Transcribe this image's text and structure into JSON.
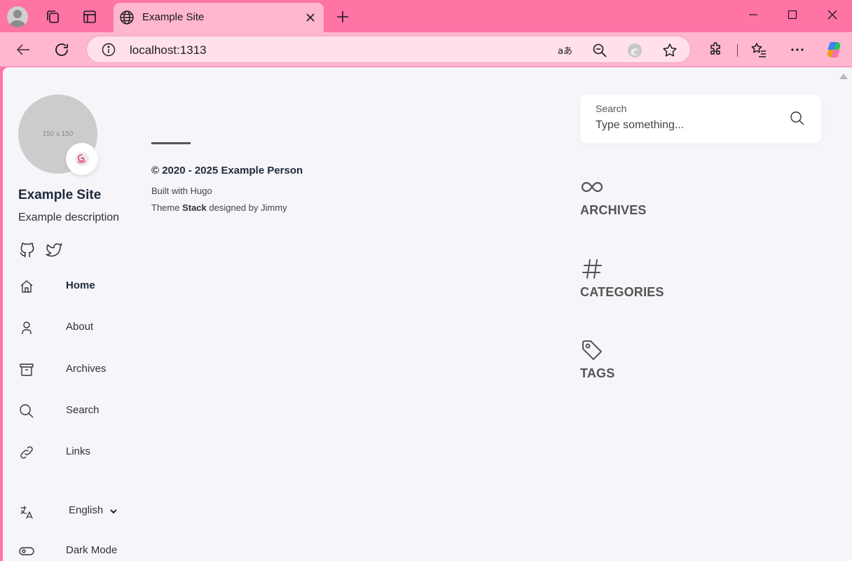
{
  "browser": {
    "tab": {
      "title": "Example Site"
    },
    "address_bar": {
      "url": "localhost:1313"
    }
  },
  "sidebar": {
    "avatar_placeholder": "150 x 150",
    "site_name": "Example Site",
    "site_description": "Example description",
    "menu": [
      {
        "label": "Home",
        "icon": "home-icon",
        "active": true
      },
      {
        "label": "About",
        "icon": "user-icon",
        "active": false
      },
      {
        "label": "Archives",
        "icon": "archive-icon",
        "active": false
      },
      {
        "label": "Search",
        "icon": "search-icon",
        "active": false
      },
      {
        "label": "Links",
        "icon": "link-icon",
        "active": false
      }
    ],
    "language": {
      "selected": "English"
    },
    "dark_mode_label": "Dark Mode"
  },
  "footer": {
    "copyright": "© 2020 - 2025 Example Person",
    "built_with": "Built with Hugo",
    "theme_prefix": "Theme ",
    "theme_name": "Stack",
    "theme_suffix": " designed by Jimmy"
  },
  "right_sidebar": {
    "search": {
      "label": "Search",
      "placeholder": "Type something..."
    },
    "widgets": [
      {
        "title": "ARCHIVES",
        "icon": "infinity-icon"
      },
      {
        "title": "CATEGORIES",
        "icon": "hash-icon"
      },
      {
        "title": "TAGS",
        "icon": "tag-icon"
      }
    ]
  },
  "colors": {
    "titlebar": "#ff73a5",
    "toolbar": "#ffb6cf",
    "page_background": "#f5f5fa",
    "card": "#ffffff"
  }
}
